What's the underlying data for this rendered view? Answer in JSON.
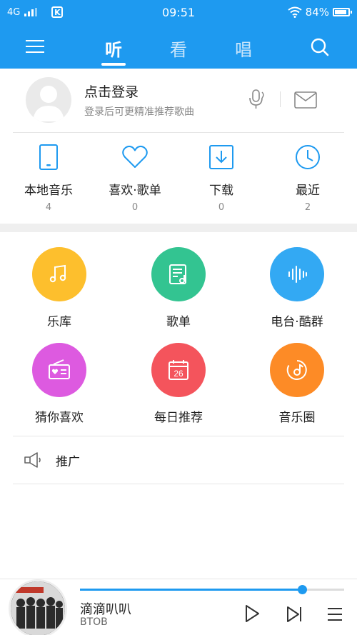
{
  "status_bar": {
    "network": "4G",
    "carrier_icon": "K",
    "time": "09:51",
    "battery": "84%"
  },
  "nav": {
    "tabs": [
      {
        "label": "听",
        "active": true
      },
      {
        "label": "看",
        "active": false
      },
      {
        "label": "唱",
        "active": false
      }
    ]
  },
  "login": {
    "title": "点击登录",
    "subtitle": "登录后可更精准推荐歌曲"
  },
  "quick_items": [
    {
      "label": "本地音乐",
      "count": "4",
      "icon": "phone-icon"
    },
    {
      "label": "喜欢·歌单",
      "count": "0",
      "icon": "heart-icon"
    },
    {
      "label": "下载",
      "count": "0",
      "icon": "download-icon"
    },
    {
      "label": "最近",
      "count": "2",
      "icon": "clock-icon"
    }
  ],
  "grid_items": [
    {
      "label": "乐库",
      "color": "#fdbf2d",
      "icon": "music-note-icon"
    },
    {
      "label": "歌单",
      "color": "#33c491",
      "icon": "playlist-icon"
    },
    {
      "label": "电台·酷群",
      "color": "#33a9f3",
      "icon": "soundwave-icon"
    },
    {
      "label": "猜你喜欢",
      "color": "#dd5ae0",
      "icon": "radio-heart-icon"
    },
    {
      "label": "每日推荐",
      "color": "#f4545c",
      "icon": "calendar-icon",
      "calendar_day": "26"
    },
    {
      "label": "音乐圈",
      "color": "#fd8b26",
      "icon": "music-circle-icon"
    }
  ],
  "promo": {
    "label": "推广",
    "icon": "megaphone-icon"
  },
  "player": {
    "title": "滴滴叭叭",
    "artist": "BTOB",
    "progress": 0.84,
    "accent": "#1e9af0"
  },
  "theme": {
    "primary": "#1e9af0"
  }
}
